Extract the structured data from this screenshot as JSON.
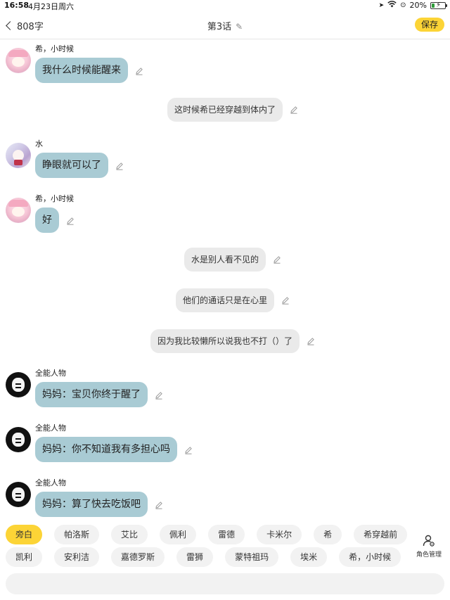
{
  "status_bar": {
    "time": "16:58",
    "date": "4月23日周六",
    "battery_text": "20%",
    "battery_level": 0.2
  },
  "nav": {
    "back_label": "808字",
    "title": "第3话",
    "save_label": "保存"
  },
  "messages": [
    {
      "type": "character",
      "speaker": "希，小时候",
      "avatar": "girl",
      "text": "我什么时候能醒来"
    },
    {
      "type": "narration",
      "text": "这时候希已经穿越到体内了"
    },
    {
      "type": "character",
      "speaker": "水",
      "avatar": "water",
      "text": "睁眼就可以了"
    },
    {
      "type": "character",
      "speaker": "希，小时候",
      "avatar": "girl",
      "text": "好"
    },
    {
      "type": "narration",
      "text": "水是别人看不见的"
    },
    {
      "type": "narration",
      "text": "他们的通话只是在心里"
    },
    {
      "type": "narration",
      "text": "因为我比较懒所以说我也不打（）了"
    },
    {
      "type": "character",
      "speaker": "全能人物",
      "avatar": "meme",
      "text": "妈妈：宝贝你终于醒了"
    },
    {
      "type": "character",
      "speaker": "全能人物",
      "avatar": "meme",
      "text": "妈妈：你不知道我有多担心吗"
    },
    {
      "type": "character",
      "speaker": "全能人物",
      "avatar": "meme",
      "text": "妈妈：算了快去吃饭吧"
    }
  ],
  "roles_row1": [
    "旁白",
    "帕洛斯",
    "艾比",
    "佩利",
    "雷德",
    "卡米尔",
    "希",
    "希穿越前",
    "希"
  ],
  "roles_row2": [
    "凯利",
    "安利洁",
    "嘉德罗斯",
    "雷狮",
    "蒙特祖玛",
    "埃米",
    "希，小时候",
    "安迷修"
  ],
  "active_role": "旁白",
  "role_manage_label": "角色管理",
  "input": {
    "placeholder": ""
  },
  "colors": {
    "accent": "#fcd436",
    "character_bubble": "#a9cbd4",
    "narration_bubble": "#eaeaea"
  }
}
